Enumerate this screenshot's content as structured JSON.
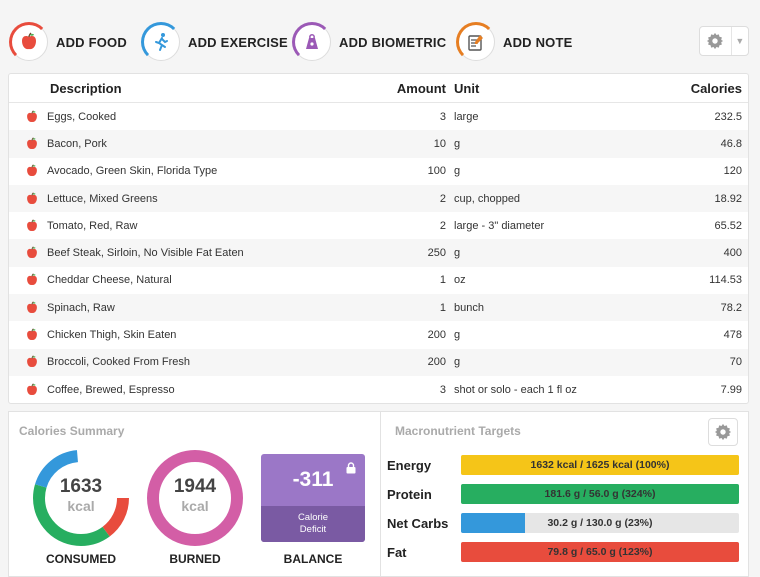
{
  "toolbar": {
    "add_food": "ADD FOOD",
    "add_exercise": "ADD EXERCISE",
    "add_biometric": "ADD BIOMETRIC",
    "add_note": "ADD NOTE",
    "colors": {
      "food": "#e84c3d",
      "exercise": "#3498db",
      "biometric": "#9b59b6",
      "note": "#e67e22"
    }
  },
  "table": {
    "headers": {
      "description": "Description",
      "amount": "Amount",
      "unit": "Unit",
      "calories": "Calories"
    },
    "rows": [
      {
        "description": "Eggs, Cooked",
        "amount": "3",
        "unit": "large",
        "calories": "232.5"
      },
      {
        "description": "Bacon, Pork",
        "amount": "10",
        "unit": "g",
        "calories": "46.8"
      },
      {
        "description": "Avocado, Green Skin, Florida Type",
        "amount": "100",
        "unit": "g",
        "calories": "120"
      },
      {
        "description": "Lettuce, Mixed Greens",
        "amount": "2",
        "unit": "cup, chopped",
        "calories": "18.92"
      },
      {
        "description": "Tomato, Red, Raw",
        "amount": "2",
        "unit": "large - 3\" diameter",
        "calories": "65.52"
      },
      {
        "description": "Beef Steak, Sirloin, No Visible Fat Eaten",
        "amount": "250",
        "unit": "g",
        "calories": "400"
      },
      {
        "description": "Cheddar Cheese, Natural",
        "amount": "1",
        "unit": "oz",
        "calories": "114.53"
      },
      {
        "description": "Spinach, Raw",
        "amount": "1",
        "unit": "bunch",
        "calories": "78.2"
      },
      {
        "description": "Chicken Thigh, Skin Eaten",
        "amount": "200",
        "unit": "g",
        "calories": "478"
      },
      {
        "description": "Broccoli, Cooked From Fresh",
        "amount": "200",
        "unit": "g",
        "calories": "70"
      },
      {
        "description": "Coffee, Brewed, Espresso",
        "amount": "3",
        "unit": "shot or solo - each 1 fl oz",
        "calories": "7.99"
      }
    ]
  },
  "calories_summary": {
    "title": "Calories Summary",
    "consumed": {
      "value": "1633",
      "unit": "kcal",
      "label": "CONSUMED"
    },
    "burned": {
      "value": "1944",
      "unit": "kcal",
      "label": "BURNED"
    },
    "balance": {
      "value": "-311",
      "line1": "Calorie",
      "line2": "Deficit",
      "label": "BALANCE"
    }
  },
  "macro_targets": {
    "title": "Macronutrient Targets",
    "rows": [
      {
        "label": "Energy",
        "text": "1632 kcal / 1625 kcal (100%)",
        "fill": 1.0,
        "color": "#f5c518"
      },
      {
        "label": "Protein",
        "text": "181.6 g / 56.0 g (324%)",
        "fill": 1.0,
        "color": "#27ae60"
      },
      {
        "label": "Net Carbs",
        "text": "30.2 g / 130.0 g (23%)",
        "fill": 0.23,
        "color": "#3498db"
      },
      {
        "label": "Fat",
        "text": "79.8 g / 65.0 g (123%)",
        "fill": 1.0,
        "color": "#e84c3d"
      }
    ]
  }
}
